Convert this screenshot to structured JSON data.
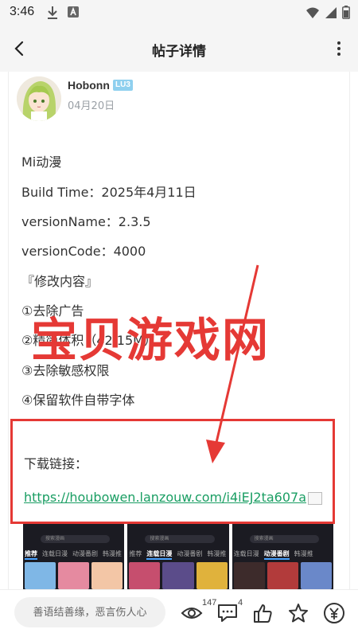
{
  "status_bar": {
    "time": "3:46"
  },
  "header": {
    "title": "帖子详情"
  },
  "author": {
    "name": "Hobonn",
    "level": "LU3",
    "date": "04月20日"
  },
  "post": {
    "lines": [
      "Mi动漫",
      "Build Time：2025年4月11日",
      "versionName：2.3.5",
      "versionCode：4000",
      "『修改内容』",
      "①去除广告",
      "②精简体积（42.15M）",
      "③去除敏感权限",
      "④保留软件自带字体"
    ],
    "download_label": "下载链接：",
    "download_url": "https://houbowen.lanzouw.com/i4iEJ2ta607a"
  },
  "watermark": "宝贝游戏网",
  "colors": {
    "accent_red": "#e53935",
    "link_green": "#1a9e63",
    "badge_blue": "#8fd0ef"
  },
  "screenshots": [
    {
      "search": "搜索漫画",
      "tabs": [
        "推荐",
        "连载日漫",
        "动漫番剧",
        "韩漫推"
      ],
      "active": 0
    },
    {
      "search": "搜索漫画",
      "tabs": [
        "推荐",
        "连载日漫",
        "动漫番剧",
        "韩漫推"
      ],
      "active": 1
    },
    {
      "search": "搜索漫画",
      "tabs": [
        "连载日漫",
        "动漫番剧",
        "韩漫推"
      ],
      "active": 1
    }
  ],
  "bottom_bar": {
    "comment_placeholder": "善语结善缘，恶言伤人心",
    "views": "147",
    "comments": "4",
    "icons": [
      "eye-icon",
      "comment-icon",
      "thumbs-up-icon",
      "star-icon",
      "coin-icon"
    ]
  }
}
